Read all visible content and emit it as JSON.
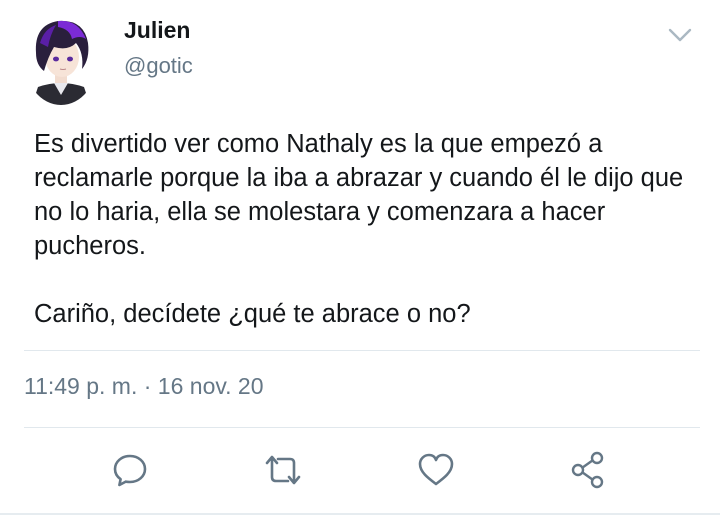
{
  "user": {
    "name": "Julien",
    "handle": "@gotic",
    "avatar_icon": "anime-avatar-purple-hair"
  },
  "tweet": {
    "paragraphs": [
      "Es divertido ver como Nathaly es la que empezó a reclamarle porque la iba a abrazar y cuando él le dijo que no lo haria, ella se molestara y comenzara a hacer pucheros.",
      "Cariño, decídete ¿qué te abrace o no?"
    ],
    "timestamp": "11:49 p. m. · 16 nov. 20"
  },
  "actions": {
    "reply_icon": "comment-icon",
    "retweet_icon": "retweet-icon",
    "like_icon": "heart-icon",
    "share_icon": "share-icon"
  },
  "colors": {
    "text": "#14171a",
    "secondary": "#657786",
    "icon": "#657786",
    "divider": "#e1e8ed"
  }
}
